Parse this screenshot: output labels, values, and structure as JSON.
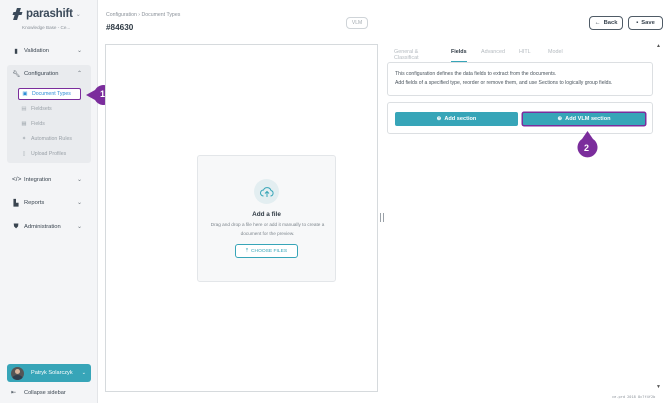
{
  "app": {
    "logo_text": "parashift",
    "kb_label": "Knowledge Base - Ce..."
  },
  "sidebar": {
    "items": [
      {
        "label": "Validation",
        "icon": "document-icon"
      },
      {
        "label": "Configuration",
        "icon": "wrench-icon"
      },
      {
        "label": "Integration",
        "icon": "code-icon"
      },
      {
        "label": "Reports",
        "icon": "bar-chart-icon"
      },
      {
        "label": "Administration",
        "icon": "shield-icon"
      }
    ],
    "config_items": [
      {
        "label": "Document Types",
        "icon": "document-type-icon",
        "active": true
      },
      {
        "label": "Fieldsets",
        "icon": "table-icon"
      },
      {
        "label": "Fields",
        "icon": "grid-icon"
      },
      {
        "label": "Automation Rules",
        "icon": "sparkle-icon"
      },
      {
        "label": "Upload Profiles",
        "icon": "file-icon"
      }
    ],
    "user_name": "Patryk Solarczyk",
    "collapse_label": "Collapse sidebar"
  },
  "badges": {
    "one": "1",
    "two": "2"
  },
  "header": {
    "breadcrumb": "Configuration › Document Types",
    "title": "#84630",
    "vlm_pill": "VLM",
    "back_label": "Back",
    "save_label": "Save"
  },
  "preview": {
    "add_file_title": "Add a file",
    "description": "Drag and drop a file here or add it manually to create a document for the preview.",
    "choose_files_label": "CHOOSE FILES"
  },
  "tabs": [
    "General & Classificat",
    "Fields",
    "Advanced",
    "HITL",
    "Model"
  ],
  "active_tab": "Fields",
  "fields_panel": {
    "info_line1": "This configuration defines the data fields to extract from the documents.",
    "info_line2": "Add fields of a specified type, reorder or remove them, and use Sections to logically group fields.",
    "add_section_label": "Add section",
    "add_vlm_section_label": "Add VLM section"
  },
  "version_text": "ce-prd 2018 8c7f4f2b",
  "colors": {
    "accent": "#37a5b8",
    "annotation": "#7b2d9c",
    "link": "#2e8fd6"
  }
}
